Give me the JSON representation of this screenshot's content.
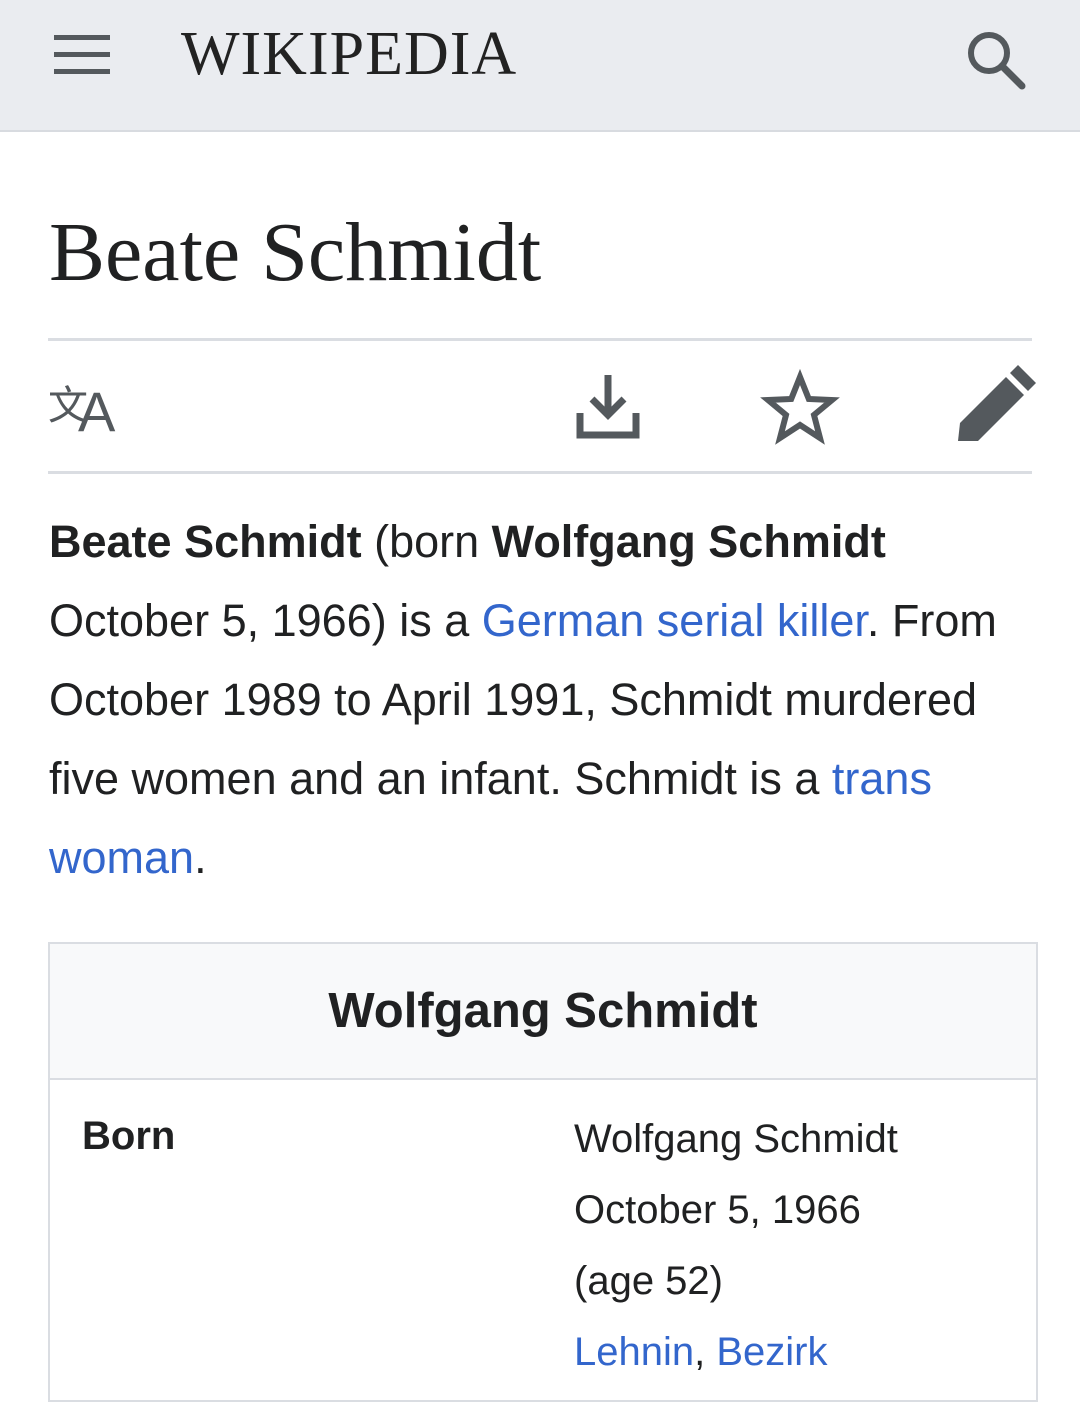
{
  "header": {
    "wordmark": "WIKIPEDIA",
    "menu_icon": "hamburger-menu-icon",
    "search_icon": "search-icon",
    "background": "#eaecf0"
  },
  "article": {
    "title": "Beate Schmidt",
    "actions": [
      {
        "icon": "language-icon"
      },
      {
        "icon": "download-icon"
      },
      {
        "icon": "star-watch-icon"
      },
      {
        "icon": "pencil-edit-icon"
      }
    ],
    "lead": {
      "name": "Beate Schmidt",
      "born_open": " (born ",
      "birth_name": "Wolfgang Schmidt",
      "after_birth": " October 5, 1966) is a ",
      "link_serial": "German serial killer",
      "middle": ". From October 1989 to April 1991, Schmidt murdered five women and an infant. Schmidt is a ",
      "link_trans": "trans woman",
      "end": "."
    },
    "link_color": "#3366cc"
  },
  "infobox": {
    "title": "Wolfgang Schmidt",
    "rows": [
      {
        "label": "Born",
        "value_lines": [
          "Wolfgang Schmidt",
          "October 5, 1966",
          "(age 52)"
        ],
        "link_1": "Lehnin",
        "separator": ", ",
        "link_2": "Bezirk"
      }
    ]
  }
}
